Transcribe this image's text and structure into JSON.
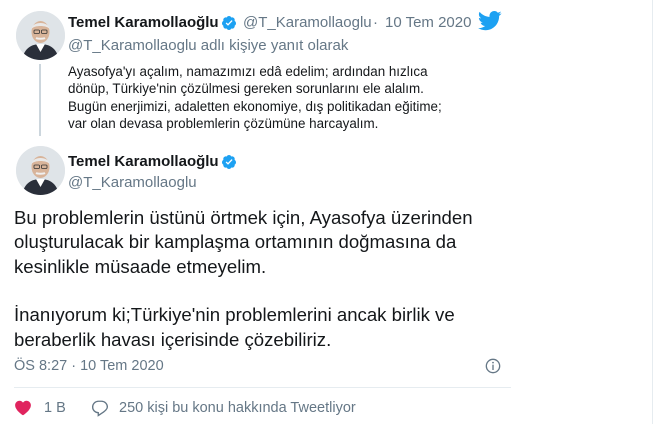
{
  "reply_tweet": {
    "name": "Temel Karamollaoğlu",
    "handle": "@T_Karamollaoglu",
    "separator": "·",
    "date": "10 Tem 2020",
    "reply_to": "@T_Karamollaoglu adlı kişiye yanıt olarak",
    "lines": [
      "Ayasofya'yı açalım, namazımızı edâ edelim; ardından hızlıca",
      "dönüp, Türkiye'nin çözülmesi gereken sorunlarını ele alalım.",
      "Bugün enerjimizi, adaletten ekonomiye, dış politikadan eğitime;",
      "var olan devasa problemlerin çözümüne harcayalım."
    ]
  },
  "main_tweet": {
    "name": "Temel Karamollaoğlu",
    "handle": "@T_Karamollaoglu",
    "paragraph1": [
      "Bu problemlerin üstünü örtmek için, Ayasofya üzerinden",
      "oluşturulacak bir kamplaşma ortamının doğmasına da",
      "kesinlikle müsaade etmeyelim."
    ],
    "paragraph2": [
      "İnanıyorum ki;Türkiye'nin problemlerini ancak birlik ve",
      "beraberlik havası içerisinde çözebiliriz."
    ],
    "timestamp": "ÖS 8:27 · 10 Tem 2020",
    "likes": "1 B",
    "talking": "250 kişi bu konu hakkında Tweetliyor"
  },
  "colors": {
    "twitter_blue": "#1da1f2",
    "secondary_text": "#657786"
  },
  "icons": [
    "twitter-bird-icon",
    "verified-badge-icon",
    "info-icon",
    "heart-icon",
    "speech-bubble-icon"
  ]
}
